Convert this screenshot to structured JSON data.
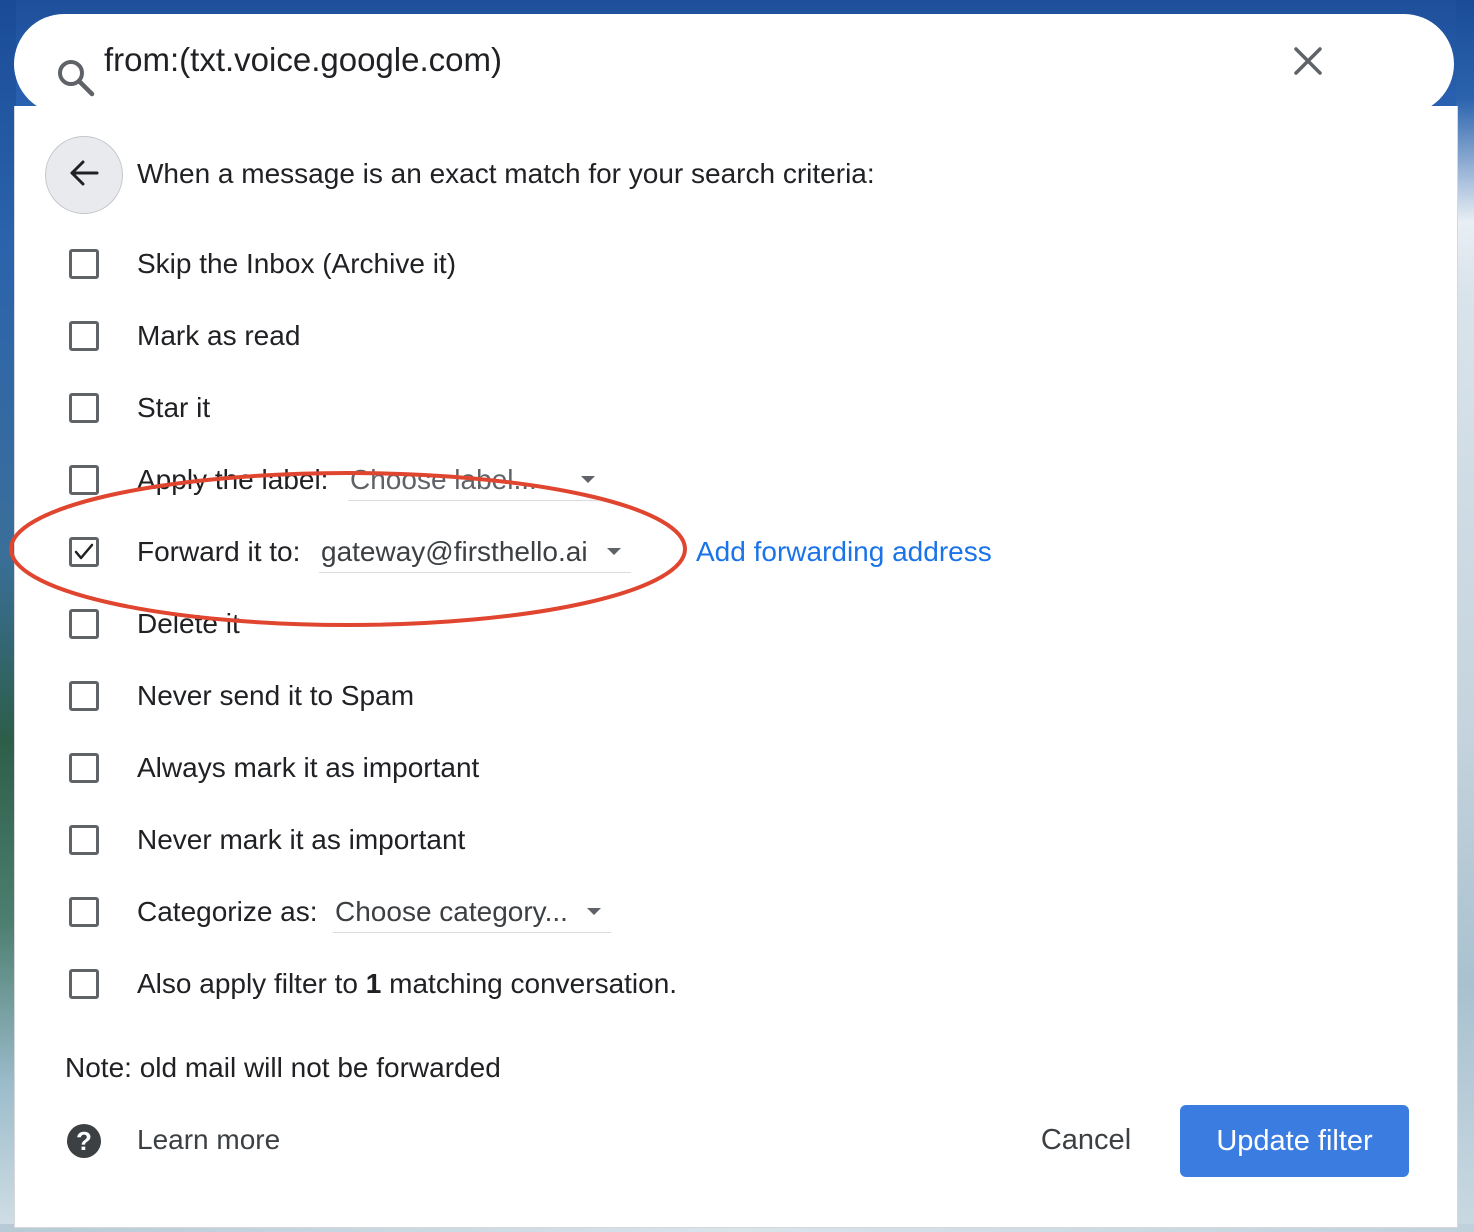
{
  "search": {
    "query": "from:(txt.voice.google.com)"
  },
  "header": {
    "text": "When a message is an exact match for your search criteria:"
  },
  "options": {
    "skip_inbox": {
      "label": "Skip the Inbox (Archive it)",
      "checked": false
    },
    "mark_read": {
      "label": "Mark as read",
      "checked": false
    },
    "star": {
      "label": "Star it",
      "checked": false
    },
    "apply_label": {
      "label": "Apply the label:",
      "select_value": "Choose label...",
      "checked": false
    },
    "forward": {
      "label": "Forward it to:",
      "select_value": "gateway@firsthello.ai",
      "checked": true,
      "link": "Add forwarding address"
    },
    "delete": {
      "label": "Delete it",
      "checked": false
    },
    "never_spam": {
      "label": "Never send it to Spam",
      "checked": false
    },
    "always_important": {
      "label": "Always mark it as important",
      "checked": false
    },
    "never_important": {
      "label": "Never mark it as important",
      "checked": false
    },
    "categorize": {
      "label": "Categorize as:",
      "select_value": "Choose category...",
      "checked": false
    },
    "also_apply": {
      "prefix": "Also apply filter to",
      "count": "1",
      "suffix": "matching conversation.",
      "checked": false
    }
  },
  "note": "Note: old mail will not be forwarded",
  "footer": {
    "learn_more": "Learn more",
    "cancel": "Cancel",
    "update": "Update filter"
  },
  "colors": {
    "link": "#1a73e8",
    "primary_button": "#3b7ce0",
    "annotation_circle": "#e0452f"
  }
}
